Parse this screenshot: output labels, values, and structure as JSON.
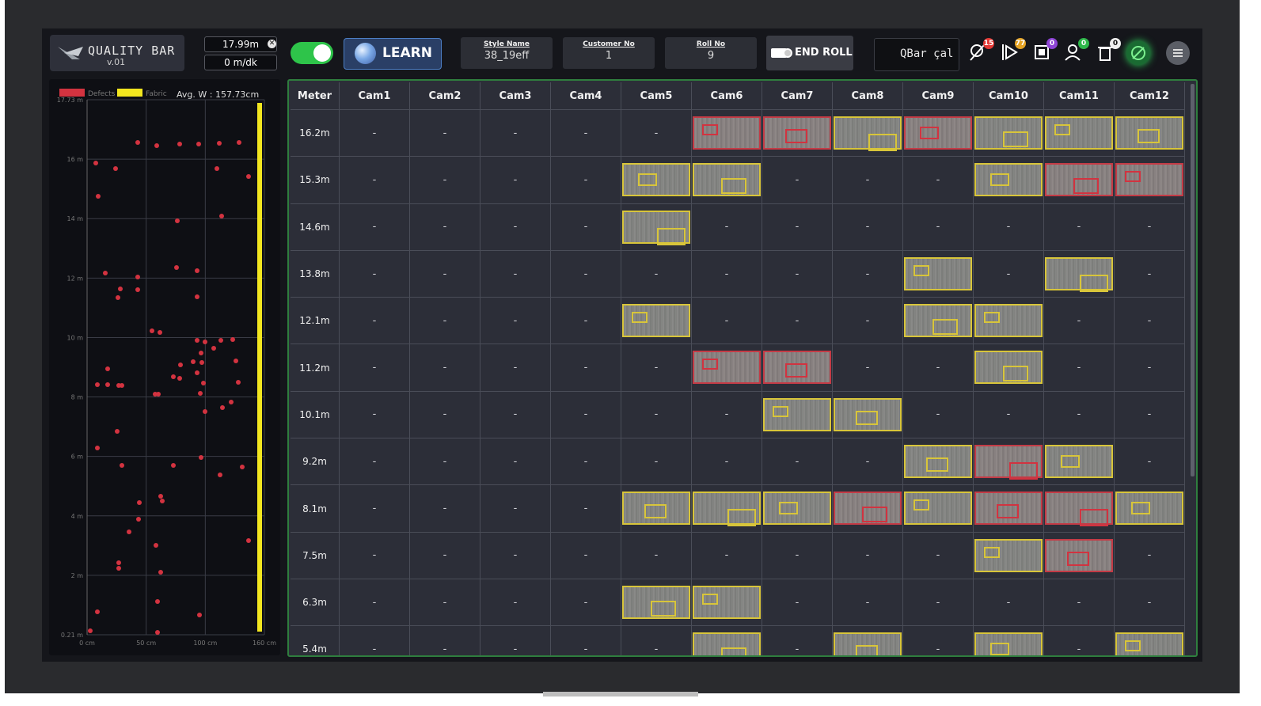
{
  "app": {
    "name": "QUALITY BAR",
    "version": "v.01"
  },
  "header": {
    "length": "17.99m",
    "speed": "0 m/dk",
    "learn_label": "LEARN",
    "style_name_label": "Style Name",
    "style_name_value": "38_19eff",
    "customer_no_label": "Customer No",
    "customer_no_value": "1",
    "roll_no_label": "Roll No",
    "roll_no_value": "9",
    "end_roll_label": "END ROLL",
    "qbar_text": "QBar çal",
    "badges": [
      {
        "icon": "no-location-icon",
        "count": "15",
        "color": "#e53935"
      },
      {
        "icon": "play-flag-icon",
        "count": "77",
        "color": "#e5a323"
      },
      {
        "icon": "chip-icon",
        "count": "0",
        "color": "#8e44d6"
      },
      {
        "icon": "user-search-icon",
        "count": "0",
        "color": "#2eb84a"
      },
      {
        "icon": "trash-icon",
        "count": "0",
        "color": "#f0f0f0"
      }
    ]
  },
  "defect_map": {
    "legend_defects": "Defects",
    "legend_fabric": "Fabric",
    "avg_width": "Avg. W : 157.73cm",
    "y_labels": [
      "17.73 m",
      "16 m",
      "14 m",
      "12 m",
      "10 m",
      "8 m",
      "6 m",
      "4 m",
      "2 m",
      "0.21 m"
    ],
    "x_labels": [
      "0 cm",
      "50 cm",
      "100 cm",
      "160 cm"
    ],
    "colors": {
      "defect": "#d33340",
      "fabric": "#f2e61f"
    }
  },
  "table": {
    "headers": [
      "Meter",
      "Cam1",
      "Cam2",
      "Cam3",
      "Cam4",
      "Cam5",
      "Cam6",
      "Cam7",
      "Cam8",
      "Cam9",
      "Cam10",
      "Cam11",
      "Cam12"
    ],
    "rows": [
      {
        "meter": "16.2m",
        "cells": [
          "-",
          "-",
          "-",
          "-",
          "-",
          "R",
          "R",
          "Y",
          "R",
          "Y",
          "Y",
          "Y"
        ]
      },
      {
        "meter": "15.3m",
        "cells": [
          "-",
          "-",
          "-",
          "-",
          "Y",
          "Y",
          "-",
          "-",
          "-",
          "Y",
          "R",
          "R"
        ]
      },
      {
        "meter": "14.6m",
        "cells": [
          "-",
          "-",
          "-",
          "-",
          "Y",
          "-",
          "-",
          "-",
          "-",
          "-",
          "-",
          "-"
        ]
      },
      {
        "meter": "13.8m",
        "cells": [
          "-",
          "-",
          "-",
          "-",
          "-",
          "-",
          "-",
          "-",
          "Y",
          "-",
          "Y",
          "-"
        ]
      },
      {
        "meter": "12.1m",
        "cells": [
          "-",
          "-",
          "-",
          "-",
          "Y",
          "-",
          "-",
          "-",
          "Y",
          "Y",
          "-",
          "-"
        ]
      },
      {
        "meter": "11.2m",
        "cells": [
          "-",
          "-",
          "-",
          "-",
          "-",
          "R",
          "R",
          "-",
          "-",
          "Y",
          "-",
          "-"
        ]
      },
      {
        "meter": "10.1m",
        "cells": [
          "-",
          "-",
          "-",
          "-",
          "-",
          "-",
          "Y",
          "Y",
          "-",
          "-",
          "-",
          "-"
        ]
      },
      {
        "meter": "9.2m",
        "cells": [
          "-",
          "-",
          "-",
          "-",
          "-",
          "-",
          "-",
          "-",
          "Y",
          "R",
          "Y",
          "-"
        ]
      },
      {
        "meter": "8.1m",
        "cells": [
          "-",
          "-",
          "-",
          "-",
          "Y",
          "Y",
          "Y",
          "R",
          "Y",
          "R",
          "R",
          "Y"
        ]
      },
      {
        "meter": "7.5m",
        "cells": [
          "-",
          "-",
          "-",
          "-",
          "-",
          "-",
          "-",
          "-",
          "-",
          "Y",
          "R",
          "-"
        ]
      },
      {
        "meter": "6.3m",
        "cells": [
          "-",
          "-",
          "-",
          "-",
          "Y",
          "Y",
          "-",
          "-",
          "-",
          "-",
          "-",
          "-"
        ]
      },
      {
        "meter": "5.4m",
        "cells": [
          "-",
          "-",
          "-",
          "-",
          "-",
          "Y",
          "-",
          "Y",
          "-",
          "Y",
          "-",
          "Y"
        ]
      }
    ]
  }
}
